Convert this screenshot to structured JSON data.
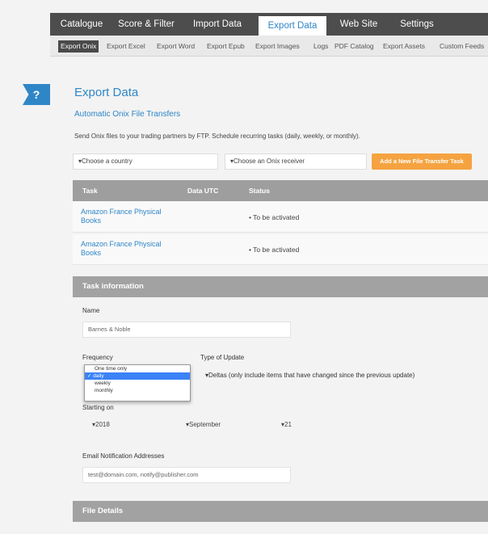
{
  "top_nav": {
    "tabs": [
      {
        "label": "Catalogue"
      },
      {
        "label": "Score & Filter"
      },
      {
        "label": "Import Data"
      },
      {
        "label": "Export Data"
      },
      {
        "label": "Web Site"
      },
      {
        "label": "Settings"
      }
    ],
    "active": "Export Data"
  },
  "sub_nav": {
    "items": [
      "Export Onix",
      "Export Excel",
      "Export Word",
      "Export Epub",
      "Export Images",
      "Logs",
      "PDF Catalog",
      "Export Assets",
      "Custom Feeds"
    ],
    "active": "Export Onix"
  },
  "help": {
    "label": "?"
  },
  "page": {
    "title": "Export Data",
    "subtitle": "Automatic Onix File Transfers",
    "description": "Send Onix files to your trading partners by FTP. Schedule recurring tasks (daily, weekly, or monthly)."
  },
  "filters": {
    "country": "▾Choose a country",
    "receiver": "▾Choose an Onix receiver",
    "add_button": "Add a New File Transfer Task"
  },
  "table": {
    "headers": [
      "Task",
      "Data UTC",
      "Status"
    ],
    "rows": [
      {
        "task": "Amazon France Physical Books",
        "status": "• To be activated"
      },
      {
        "task": "Amazon France Physical Books",
        "status": "• To be activated"
      }
    ]
  },
  "task_info": {
    "section_title": "Task information",
    "name_label": "Name",
    "name_value": "Barnes & Noble",
    "frequency_label": "Frequency",
    "frequency_options": [
      "One time only",
      "✓ daily",
      "weekly",
      "monthly"
    ],
    "update_type_label": "Type of Update",
    "update_type_value": "▾Deltas (only include items that have changed since the previous update)",
    "starting_on_label": "Starting on",
    "year": "▾2018",
    "month": "▾September",
    "day": "▾21",
    "email_label": "Email Notification Addresses",
    "email_value": "test@domain.com, notify@publisher.com"
  },
  "file_details": {
    "section_title": "File Details"
  },
  "colors": {
    "accent": "#2f86c7",
    "orange": "#f5a340",
    "nav_dark": "#4d4d4d"
  }
}
